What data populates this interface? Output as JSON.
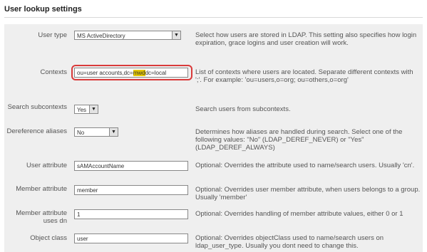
{
  "page": {
    "heading": "User lookup settings"
  },
  "rows": {
    "user_type": {
      "label": "User type",
      "value": "MS ActiveDirectory",
      "desc": "Select how users are stored in LDAP. This setting also specifies how login expiration, grace logins and user creation will work."
    },
    "contexts": {
      "label": "Contexts",
      "value_pre": "ou=user accounts,dc=",
      "value_mark": "mwd",
      "value_post": "dc=local",
      "desc": "List of contexts where users are located. Separate different contexts with ';'. For example: 'ou=users,o=org; ou=others,o=org'"
    },
    "search_subcontexts": {
      "label": "Search subcontexts",
      "value": "Yes",
      "desc": "Search users from subcontexts."
    },
    "dereference_aliases": {
      "label": "Dereference aliases",
      "value": "No",
      "desc": "Determines how aliases are handled during search. Select one of the following values: \"No\" (LDAP_DEREF_NEVER) or \"Yes\" (LDAP_DEREF_ALWAYS)"
    },
    "user_attribute": {
      "label": "User attribute",
      "value": "sAMAccountName",
      "desc": "Optional: Overrides the attribute used to name/search users. Usually 'cn'."
    },
    "member_attribute": {
      "label": "Member attribute",
      "value": "member",
      "desc": "Optional: Overrides user member attribute, when users belongs to a group. Usually 'member'"
    },
    "member_attribute_uses_dn": {
      "label": "Member attribute uses dn",
      "value": "1",
      "desc": "Optional: Overrides handling of member attribute values, either 0 or 1"
    },
    "object_class": {
      "label": "Object class",
      "value": "user",
      "desc": "Optional: Overrides objectClass used to name/search users on ldap_user_type. Usually you dont need to change this."
    }
  },
  "colors": {
    "highlight_border": "#d93a3a",
    "text_marker": "#e6c800",
    "panel_bg": "#efefef"
  }
}
